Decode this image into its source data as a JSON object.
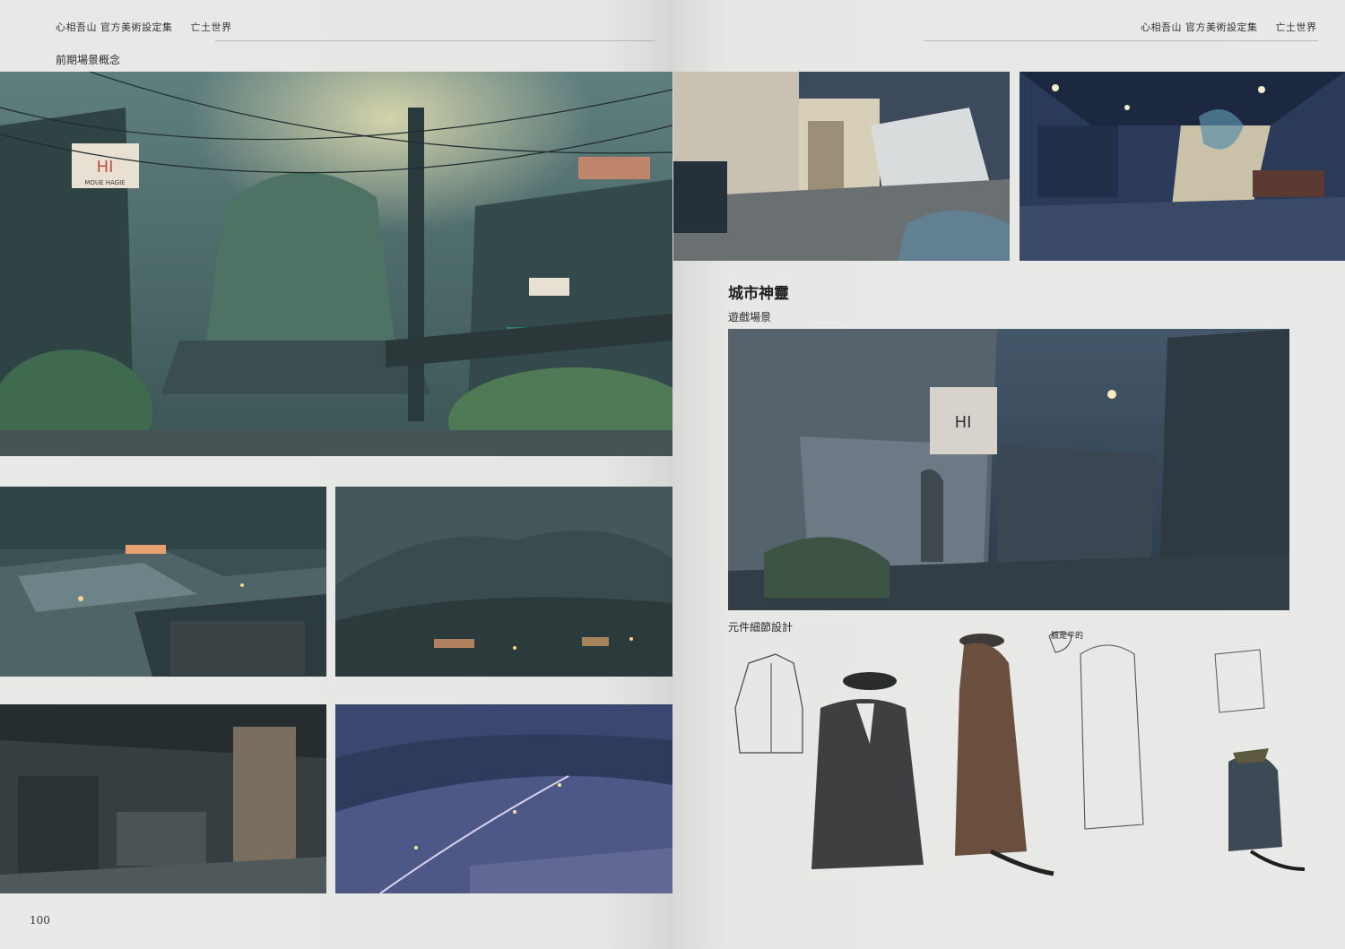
{
  "left_page": {
    "header": {
      "book_title": "心相吾山 官方美術設定集",
      "chapter": "亡土世界"
    },
    "section_label": "前期場景概念",
    "page_number": "100",
    "main_art": {
      "sign_text": "HI",
      "sign_sub": "MOUE HAGIE"
    }
  },
  "right_page": {
    "header": {
      "book_title": "心相吾山 官方美術設定集",
      "chapter": "亡土世界"
    },
    "section_title": "城市神靈",
    "subsection_game_scene": "遊戲場景",
    "subsection_detail": "元件細節設計",
    "sketch_note": "臉是平的",
    "scene_sign": "HI"
  },
  "colors": {
    "paper": "#e8e8e6",
    "night_teal": "#3d5a5c",
    "night_blue": "#2c3a55",
    "lamp_glow": "#f3e7b0",
    "neon_orange": "#e8745a"
  }
}
